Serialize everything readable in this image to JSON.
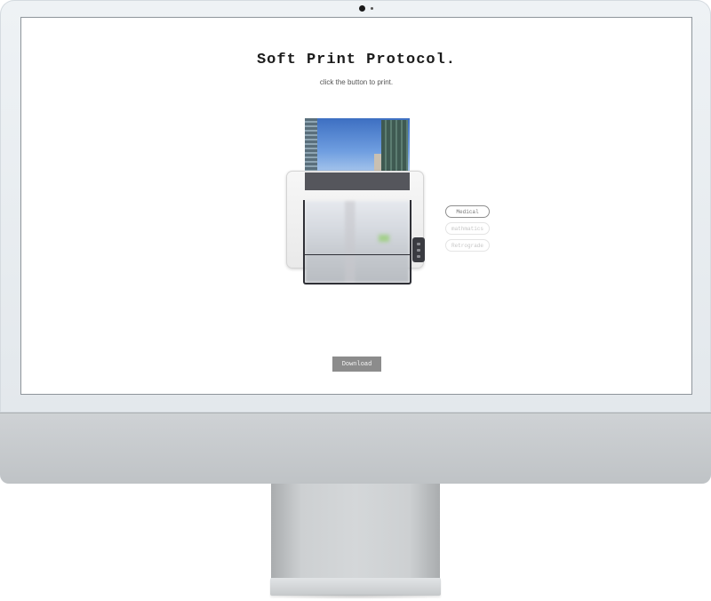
{
  "page": {
    "title": "Soft Print Protocol.",
    "subtitle": "click the button to print."
  },
  "options": [
    {
      "label": "Medical",
      "state": "selected"
    },
    {
      "label": "mathmatics",
      "state": "unselected"
    },
    {
      "label": "Retrograde",
      "state": "unselected"
    }
  ],
  "download_label": "Download",
  "colors": {
    "download_button": "#8c8c8c",
    "printer_slot": "#55565c",
    "title_text": "#1b1b1b"
  },
  "icons": [
    "printer-illustration",
    "camera-icon"
  ]
}
